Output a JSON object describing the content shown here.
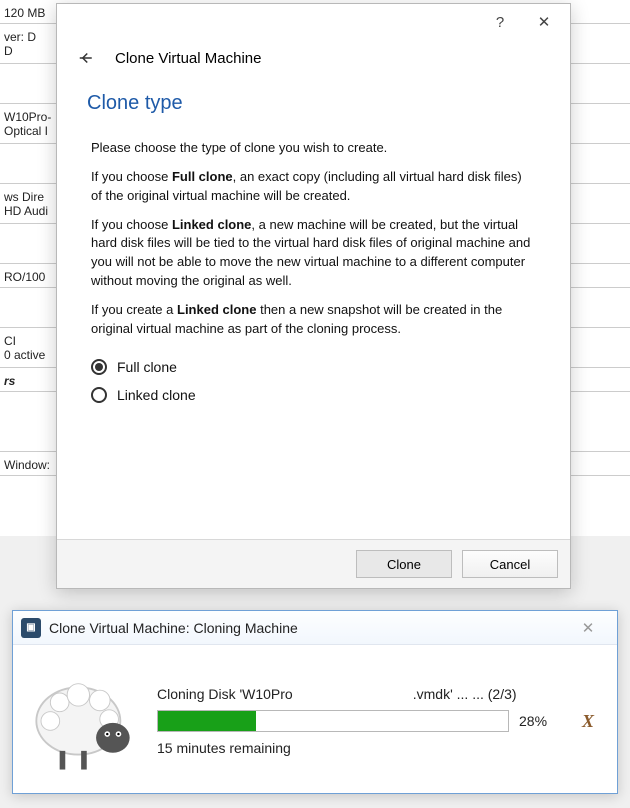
{
  "background": {
    "sidebar_fragments": [
      "120 MB",
      "ver:   D",
      "D",
      "",
      "W10Pro-",
      "Optical I",
      "",
      "ws Dire",
      "HD Audi",
      "",
      "RO/100",
      "",
      "CI",
      "0 active",
      "rs",
      "",
      "Window:"
    ]
  },
  "dialog": {
    "wizard_title": "Clone Virtual Machine",
    "section_title": "Clone type",
    "intro": "Please choose the type of clone you wish to create.",
    "full_text_before": "If you choose ",
    "full_bold": "Full clone",
    "full_text_after": ", an exact copy (including all virtual hard disk files) of the original virtual machine will be created.",
    "linked_text_before": "If you choose ",
    "linked_bold": "Linked clone",
    "linked_text_after": ", a new machine will be created, but the virtual hard disk files will be tied to the virtual hard disk files of original machine and you will not be able to move the new virtual machine to a different computer without moving the original as well.",
    "snapshot_text_before": "If you create a ",
    "snapshot_bold": "Linked clone",
    "snapshot_text_after": " then a new snapshot will be created in the original virtual machine as part of the cloning process.",
    "radio_full": "Full clone",
    "radio_linked": "Linked clone",
    "selected": "full",
    "btn_clone": "Clone",
    "btn_cancel": "Cancel"
  },
  "progress": {
    "title": "Clone Virtual Machine: Cloning Machine",
    "task_prefix": "Cloning Disk 'W10Pro",
    "task_suffix": ".vmdk' ... ... (2/3)",
    "percent": 28,
    "percent_label": "28%",
    "time_remaining": "15 minutes remaining"
  }
}
